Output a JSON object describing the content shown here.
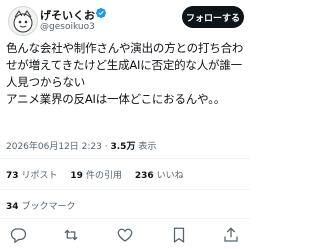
{
  "author": {
    "display_name": "げそいくお",
    "handle": "@gesoikuo3"
  },
  "follow_button_label": "フォローする",
  "tweet": {
    "text": "色んな会社や制作さんや演出の方との打ち合わせが増えてきたけど生成AIに否定的な人が誰一人見つからない\nアニメ業界の反AIは一体どこにおるんや。。",
    "timestamp": "2026年06月12日 2:23",
    "views_count": "3.5万",
    "views_label": "表示"
  },
  "stats": {
    "reposts": {
      "count": "73",
      "label": "リポスト"
    },
    "quotes": {
      "count": "19",
      "label": "件の引用"
    },
    "likes": {
      "count": "236",
      "label": "いいね"
    },
    "bookmarks": {
      "count": "34",
      "label": "ブックマーク"
    }
  },
  "icons": {
    "verified": "verified-badge-icon",
    "actions": [
      "reply-icon",
      "repost-icon",
      "like-icon",
      "bookmark-icon",
      "share-icon"
    ]
  },
  "colors": {
    "verified": "#1d9bf0",
    "follow_button_bg": "#0f1419",
    "secondary_text": "#536471"
  }
}
